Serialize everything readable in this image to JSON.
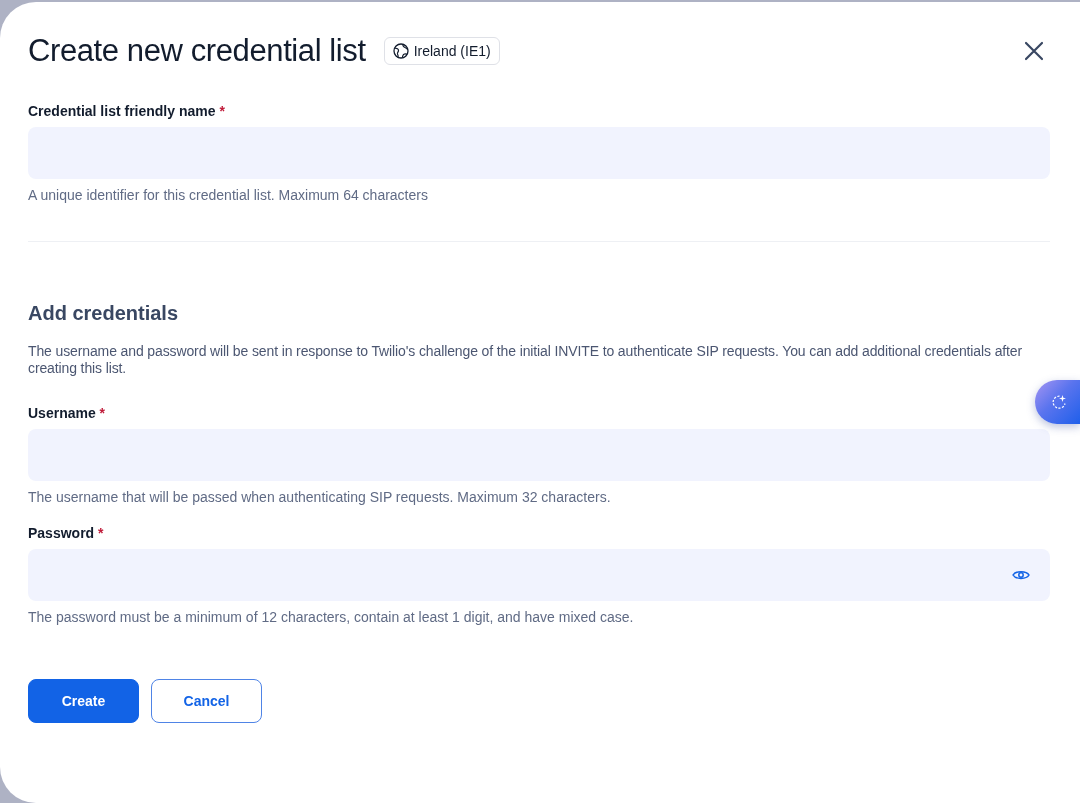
{
  "dialog": {
    "title": "Create new credential list",
    "region_badge": "Ireland (IE1)"
  },
  "fields": [
    {
      "kind": "text",
      "label": "Credential list friendly name",
      "required_mark": "*",
      "help": "A unique identifier for this credential list. Maximum 64 characters"
    }
  ],
  "section": {
    "heading": "Add credentials",
    "description": "The username and password will be sent in response to Twilio's challenge of the initial INVITE to authenticate SIP requests. You can add additional credentials after creating this list."
  },
  "credential_fields": [
    {
      "kind": "text",
      "label": "Username",
      "required_mark": "*",
      "help": "The username that will be passed when authenticating SIP requests. Maximum 32 characters."
    },
    {
      "kind": "password",
      "label": "Password",
      "required_mark": "*",
      "help": "The password must be a minimum of 12 characters, contain at least 1 digit, and have mixed case."
    }
  ],
  "buttons": [
    {
      "kind": "primary",
      "label": "Create"
    },
    {
      "kind": "secondary",
      "label": "Cancel"
    }
  ]
}
